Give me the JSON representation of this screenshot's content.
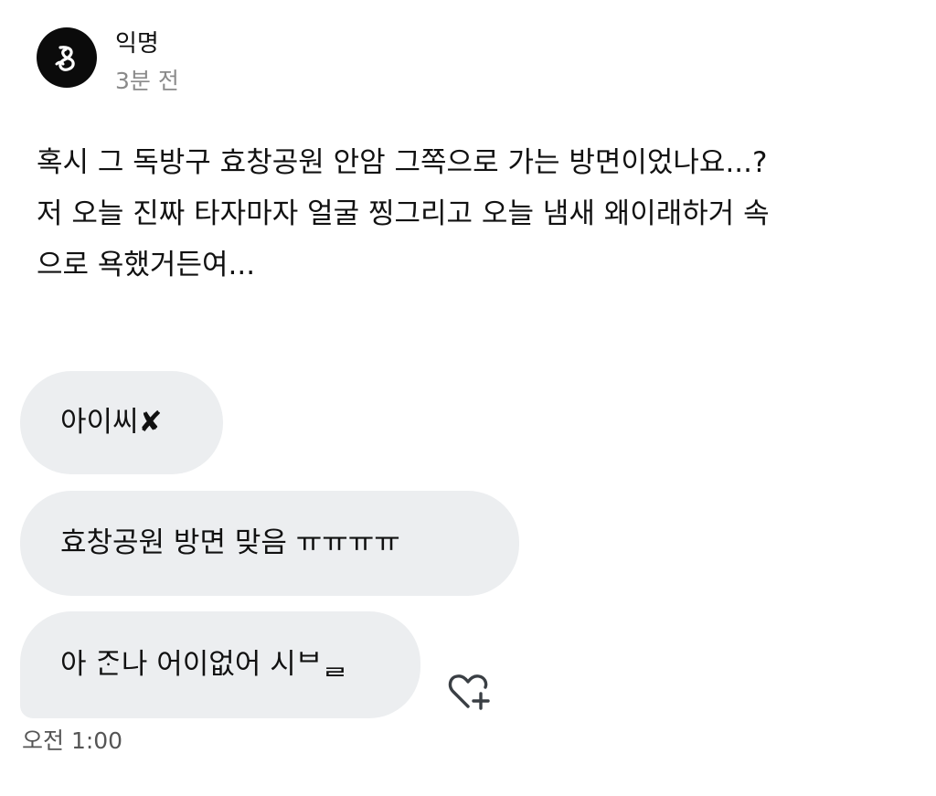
{
  "post": {
    "author": "익명",
    "time": "3분 전",
    "avatar_icon": "logo-icon",
    "lines": [
      "혹시 그 독방구 효창공원 안암 그쪽으로 가는 방면이었나요...?",
      "저 오늘 진짜 타자마자 얼굴 찡그리고 오늘 냄새 왜이래하거 속",
      "으로 욕했거든여..."
    ]
  },
  "messages": [
    {
      "text": "아이씨✘"
    },
    {
      "text": "효창공원 방면 맞음 ㅠㅠㅠㅠ"
    },
    {
      "text": "아 ᄌᆞᆫ나 어이없어 시ᄇᆯ"
    }
  ],
  "message_time": "오전 1:00",
  "reaction": {
    "icon": "heart-plus-icon"
  },
  "colors": {
    "avatar_bg": "#0b0b0b",
    "bubble_bg": "#eceef0",
    "secondary_text": "#8a8a8a"
  }
}
